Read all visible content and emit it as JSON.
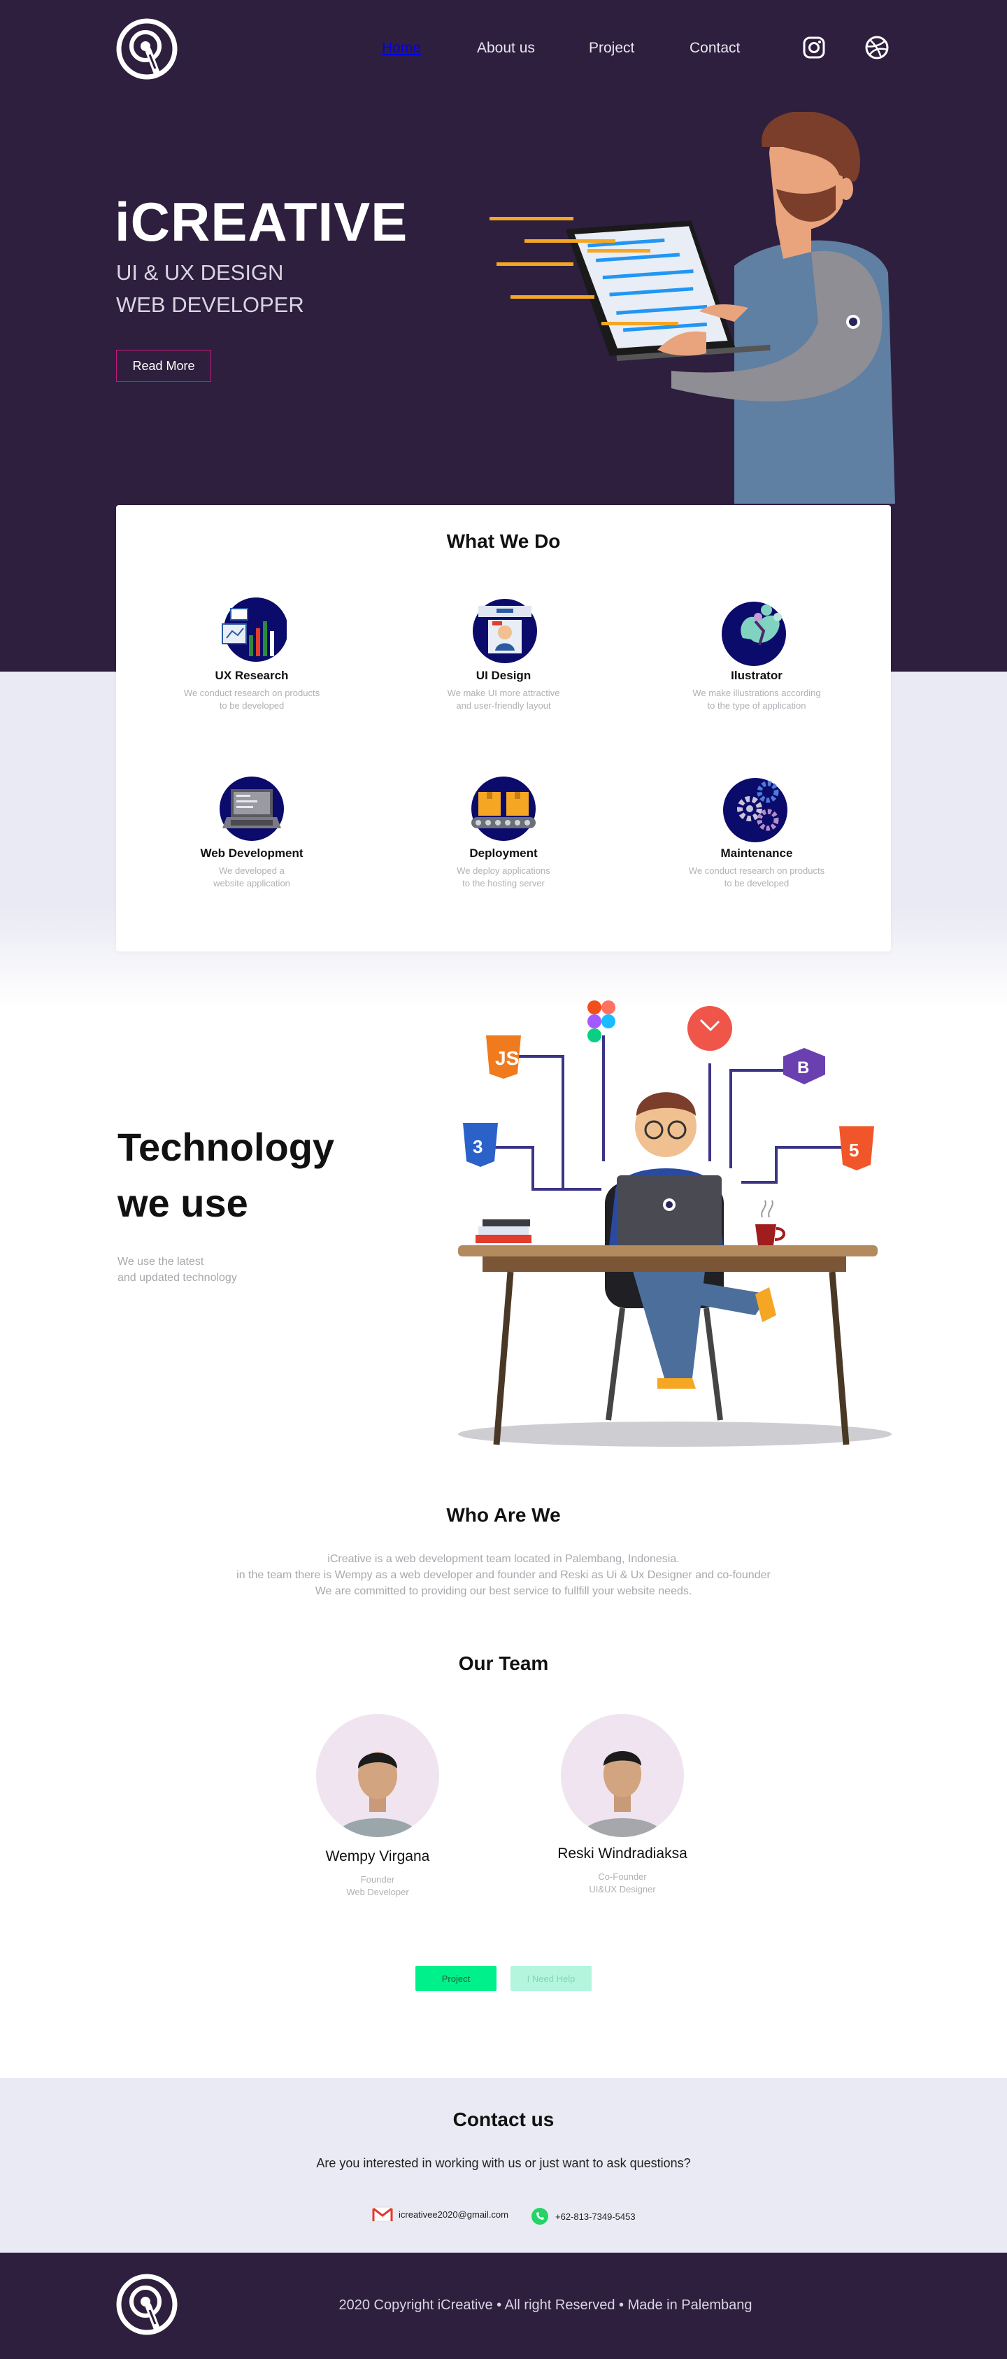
{
  "nav": {
    "links": [
      {
        "label": "Home",
        "active": true
      },
      {
        "label": "About us",
        "active": false
      },
      {
        "label": "Project",
        "active": false
      },
      {
        "label": "Contact",
        "active": false
      }
    ]
  },
  "hero": {
    "title": "iCREATIVE",
    "subtitle_1": "UI & UX DESIGN",
    "subtitle_2": "WEB DEVELOPER",
    "button": "Read More"
  },
  "what_we_do": {
    "title": "What We Do",
    "services": [
      {
        "name": "UX Research",
        "desc_1": "We conduct research on products",
        "desc_2": "to be developed"
      },
      {
        "name": "UI Design",
        "desc_1": "We make UI more attractive",
        "desc_2": "and user-friendly layout"
      },
      {
        "name": "Ilustrator",
        "desc_1": "We make illustrations according",
        "desc_2": "to the type of application"
      },
      {
        "name": "Web Development",
        "desc_1": "We developed a",
        "desc_2": "website application"
      },
      {
        "name": "Deployment",
        "desc_1": "We deploy applications",
        "desc_2": "to the hosting server"
      },
      {
        "name": "Maintenance",
        "desc_1": "We conduct research on products",
        "desc_2": "to be developed"
      }
    ]
  },
  "technology": {
    "title_1": "Technology",
    "title_2": "we use",
    "desc_1": "We use the latest",
    "desc_2": "and updated technology"
  },
  "who": {
    "title": "Who Are We",
    "line_1": "iCreative is a web development team located in Palembang, Indonesia.",
    "line_2": "in the team there is Wempy as a web developer and founder and Reski as Ui & Ux Designer and co-founder",
    "line_3": "We are committed to  providing our best service to fullfill your website needs."
  },
  "team": {
    "title": "Our Team",
    "members": [
      {
        "name": "Wempy Virgana",
        "role_1": "Founder",
        "role_2": "Web Developer"
      },
      {
        "name": "Reski Windradiaksa",
        "role_1": "Co-Founder",
        "role_2": "UI&UX Designer"
      }
    ],
    "btn_project": "Project",
    "btn_help": "I Need Help"
  },
  "contact": {
    "title": "Contact us",
    "question": "Are you interested in working with us or just want to ask questions?",
    "email": "icreativee2020@gmail.com",
    "phone": "+62-813-7349-5453"
  },
  "footer": {
    "text": "2020  Copyright iCreative •  All right Reserved • Made in Palembang"
  },
  "colors": {
    "primary": "#2e1f3e",
    "accent": "#c2197d",
    "green": "#00f08c",
    "band": "#e9eaf3"
  }
}
